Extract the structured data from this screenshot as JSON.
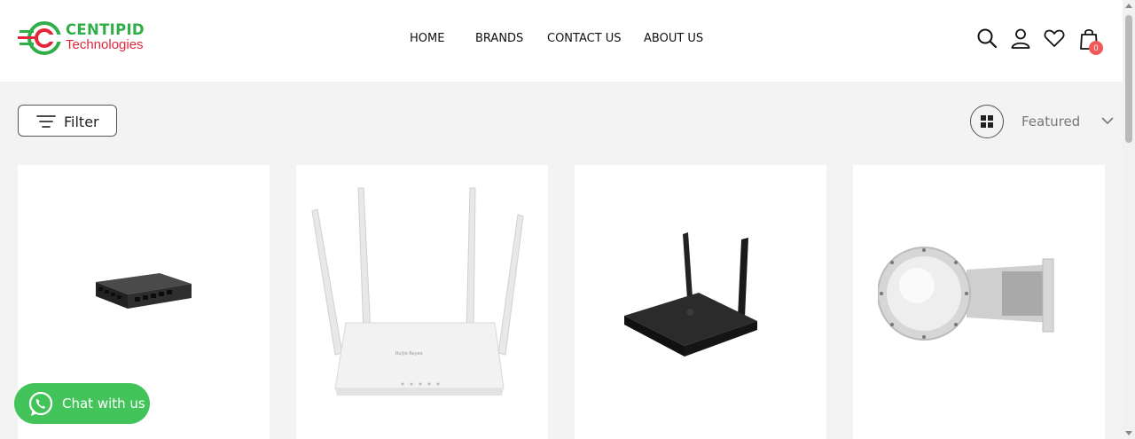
{
  "header": {
    "logo": {
      "line1": "CENTIPID",
      "line2": "Technologies",
      "icon": "centipid-logo-icon"
    },
    "nav": [
      {
        "label": "HOME"
      },
      {
        "label": "BRANDS"
      },
      {
        "label": "CONTACT US"
      },
      {
        "label": "ABOUT US"
      }
    ],
    "icons": [
      "search-icon",
      "account-icon",
      "wishlist-heart-icon",
      "cart-bag-icon"
    ],
    "cart_count": "0"
  },
  "toolbar": {
    "filter_label": "Filter",
    "grid_view_icon": "grid-view-icon",
    "sort_selected": "Featured"
  },
  "products": [
    {
      "image": "ethernet-switch-image"
    },
    {
      "image": "white-wifi-router-image"
    },
    {
      "image": "black-wifi-router-image"
    },
    {
      "image": "outdoor-wireless-bridge-image"
    }
  ],
  "chat": {
    "label": "Chat with us",
    "icon": "whatsapp-icon"
  },
  "colors": {
    "brand_green": "#2fae49",
    "brand_red": "#e3263a",
    "badge": "#ef5b5b",
    "chat_green": "#43c45a"
  }
}
